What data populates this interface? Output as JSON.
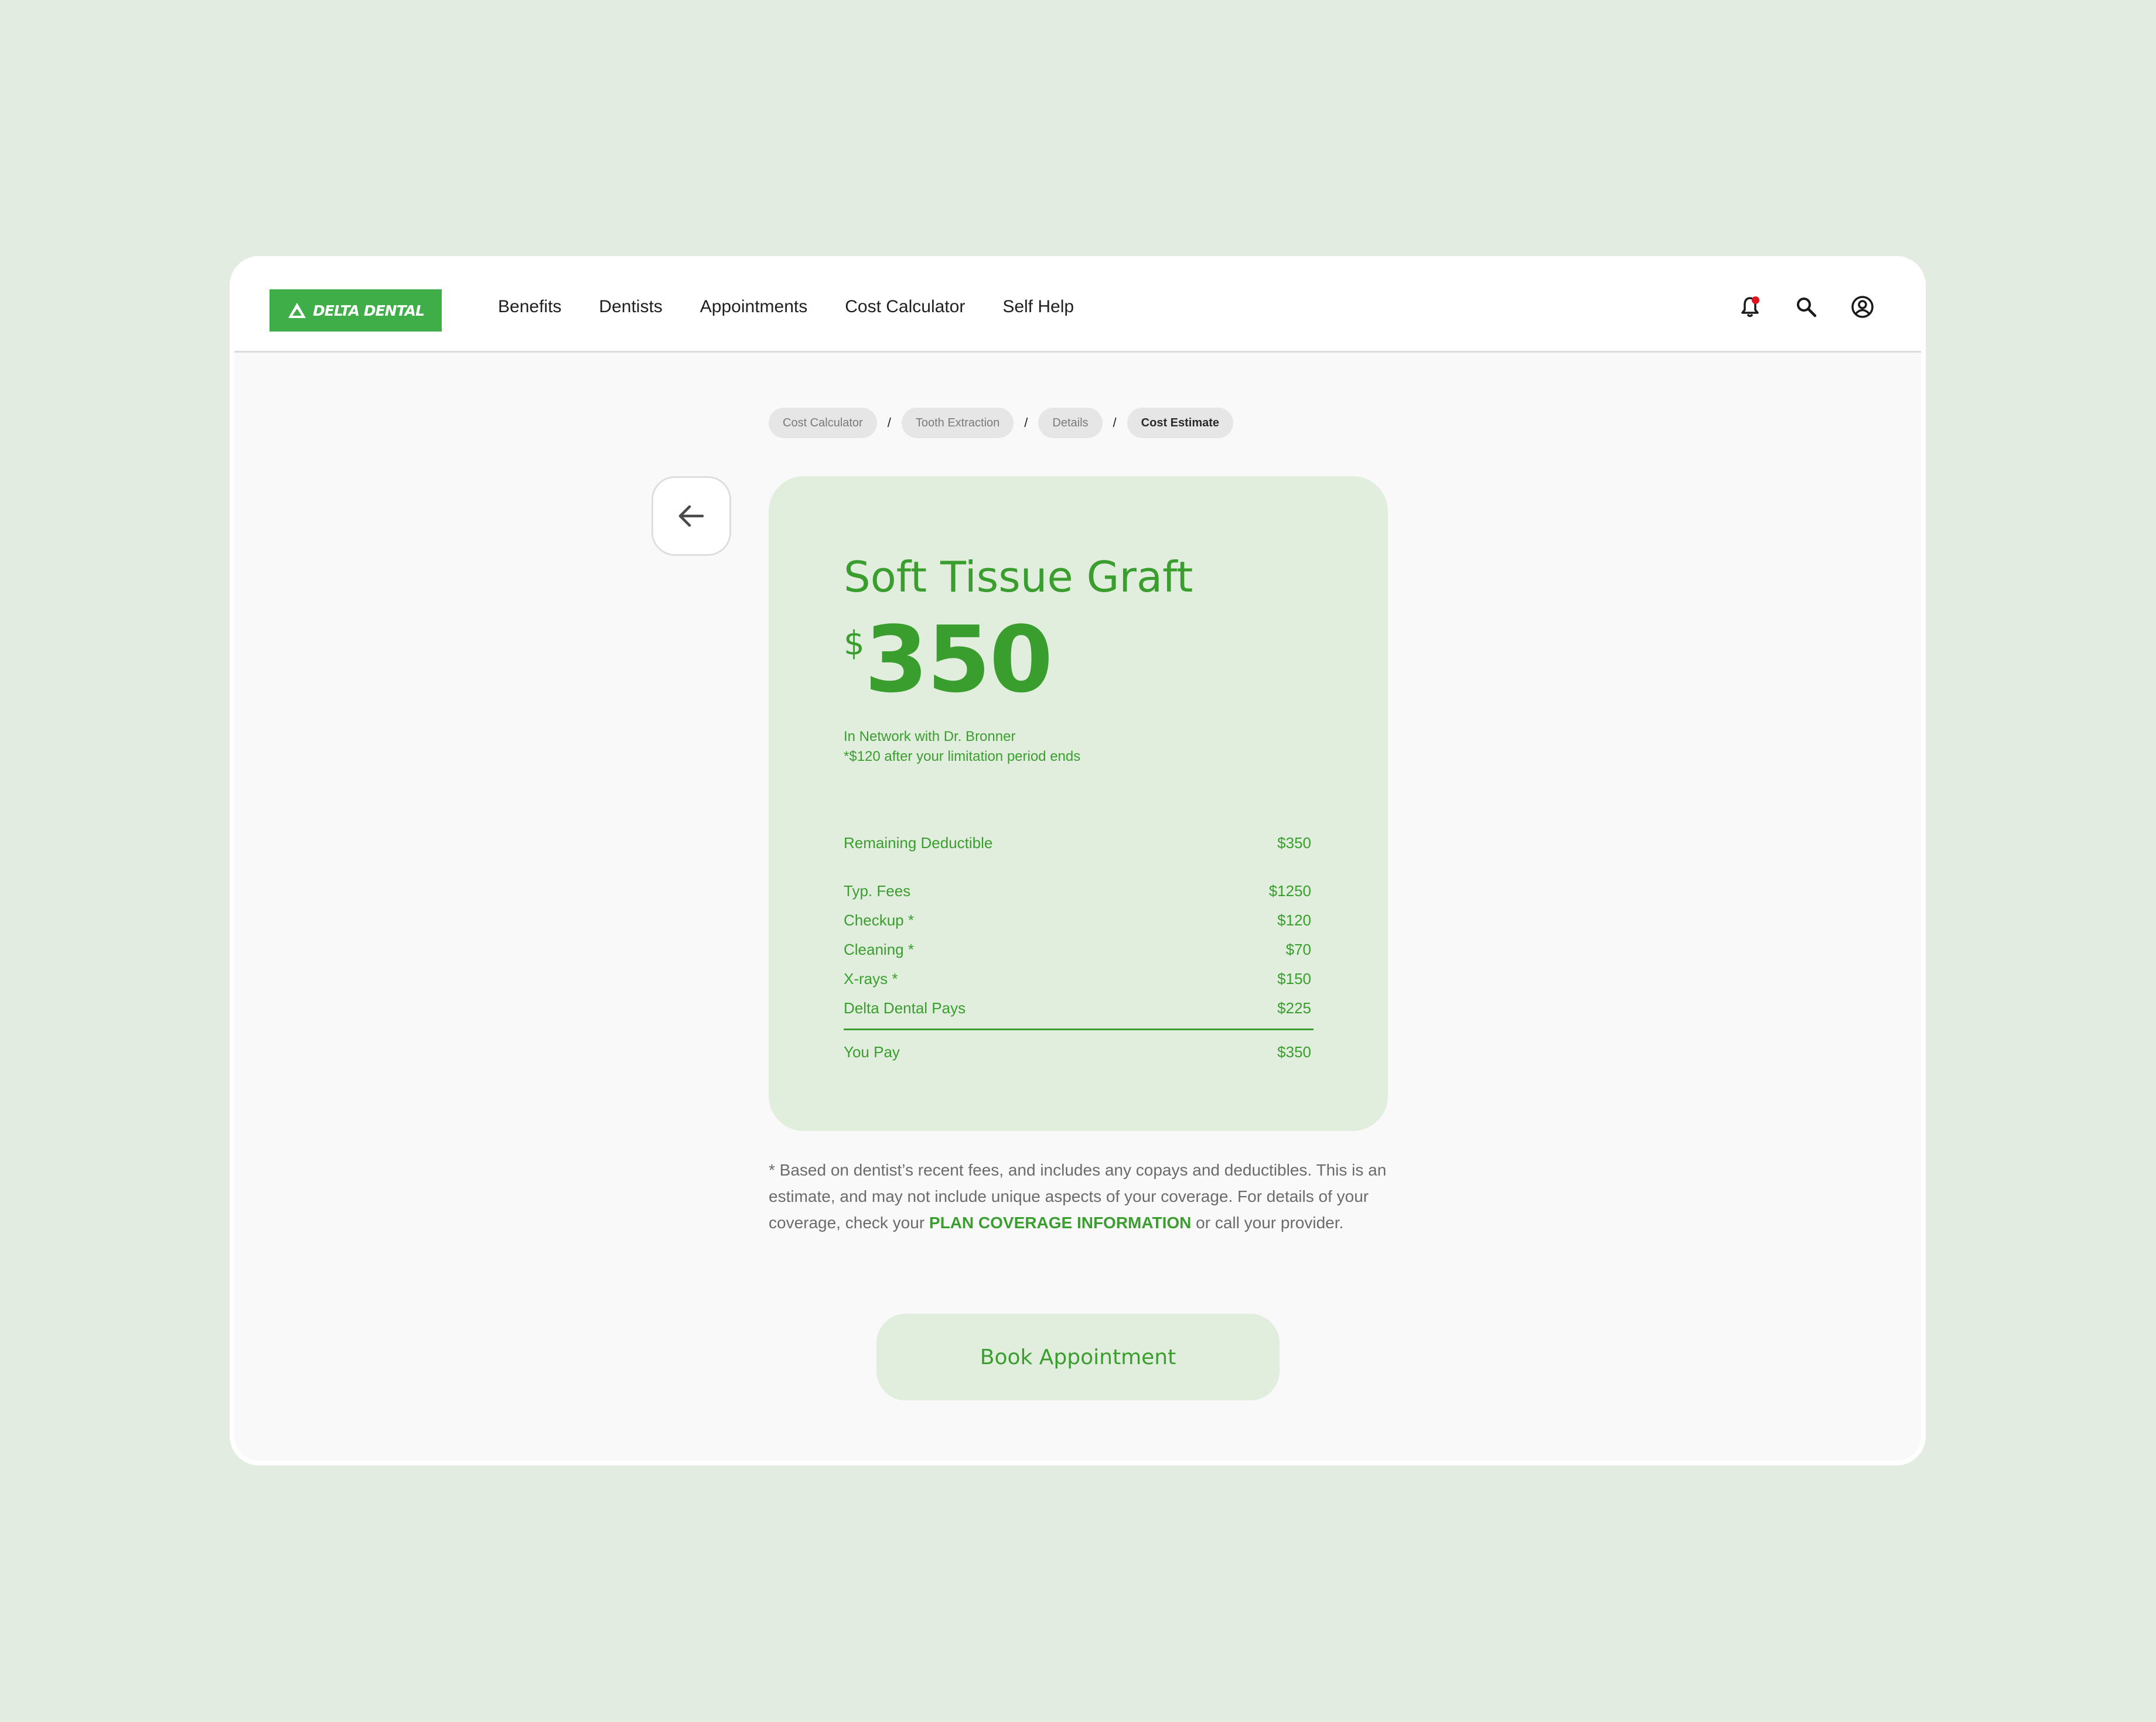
{
  "brand": {
    "logo_text": "DELTA DENTAL",
    "color": "#3fae49"
  },
  "nav": {
    "items": [
      "Benefits",
      "Dentists",
      "Appointments",
      "Cost Calculator",
      "Self Help"
    ]
  },
  "header_icons": [
    "bell-icon",
    "search-icon",
    "user-account-icon"
  ],
  "breadcrumb": [
    "Cost Calculator",
    "Tooth Extraction",
    "Details",
    "Cost Estimate"
  ],
  "breadcrumb_separator": "/",
  "estimate": {
    "title": "Soft Tissue Graft",
    "currency": "$",
    "amount": "350",
    "note_line1": "In Network with Dr. Bronner",
    "note_line2": "*$120 after your limitation period ends",
    "deductible": {
      "label": "Remaining Deductible",
      "value": "$350"
    },
    "items": [
      {
        "label": "Typ. Fees",
        "value": "$1250"
      },
      {
        "label": "Checkup *",
        "value": "$120"
      },
      {
        "label": "Cleaning *",
        "value": "$70"
      },
      {
        "label": "X-rays *",
        "value": "$150"
      },
      {
        "label": "Delta Dental Pays",
        "value": "$225"
      }
    ],
    "total": {
      "label": "You Pay",
      "value": "$350"
    }
  },
  "disclaimer": {
    "text_before": "* Based on dentist’s recent fees, and includes any copays and deductibles. This is an estimate, and may not include unique aspects of your coverage. For details of your coverage, check your ",
    "link": "PLAN COVERAGE INFORMATION",
    "text_after": " or call your provider."
  },
  "book_button": "Book Appointment",
  "colors": {
    "accent": "#3a9e2e",
    "card_bg": "#e1eedd",
    "page_bg": "#e3ece0",
    "notification": "#e0161e"
  }
}
